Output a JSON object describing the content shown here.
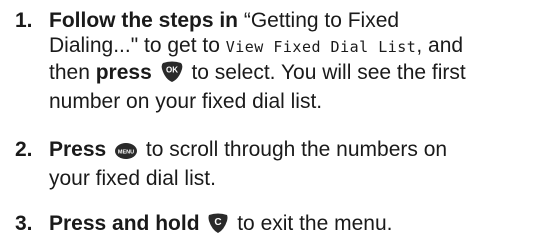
{
  "steps": [
    {
      "number": "1.",
      "line1_bold": "Follow the steps in",
      "line1_text": " “Getting to Fixed",
      "line2_text_a": "Dialing...\" to get to ",
      "line2_display": "View Fixed Dial List",
      "line2_text_b": ", and",
      "line3_text_a": "then ",
      "line3_bold": "press",
      "line3_key_icon": "ok-key-icon",
      "line3_key_label": "OK",
      "line3_text_b": " to select. You will see the first",
      "line4_text": "number on your fixed dial list."
    },
    {
      "number": "2.",
      "line1_bold": "Press",
      "line1_key_icon": "menu-key-icon",
      "line1_key_label": "MENU",
      "line1_text": " to scroll through the numbers on",
      "line2_text": "your fixed dial list."
    },
    {
      "number": "3.",
      "line1_bold": "Press and hold",
      "line1_key_icon": "clear-key-icon",
      "line1_key_label": "C",
      "line1_text": " to exit the menu."
    }
  ],
  "colors": {
    "text": "#1a1a1a",
    "key_fill": "#2a2a2a",
    "key_label": "#ffffff"
  }
}
